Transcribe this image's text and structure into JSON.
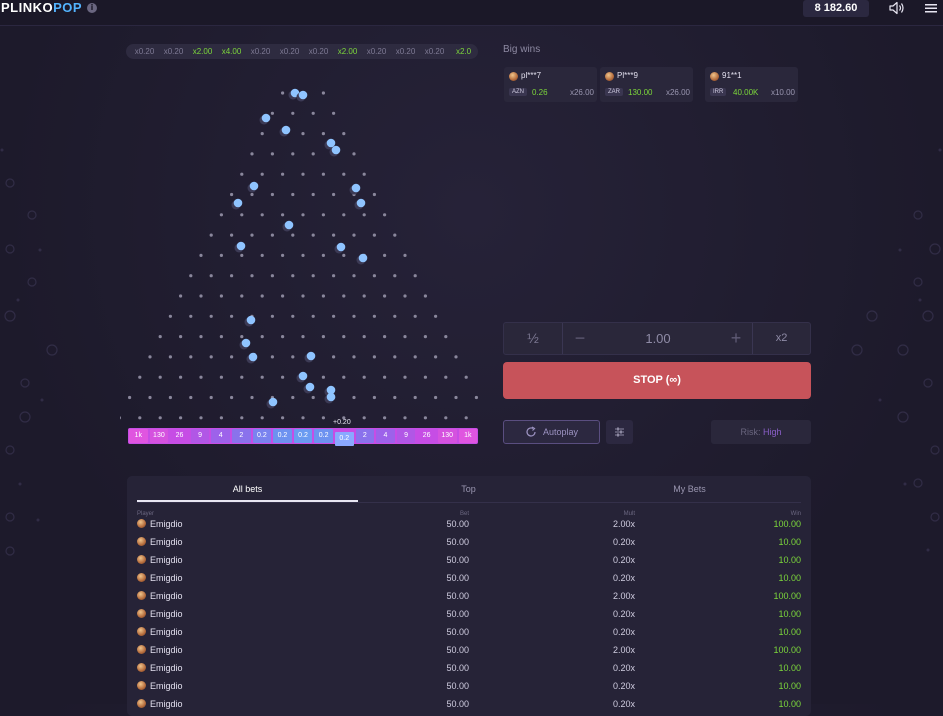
{
  "header": {
    "logo_main": "PLINKO",
    "logo_accent": "POP",
    "info_glyph": "i",
    "balance": "8 182.60",
    "icons": [
      "info-icon",
      "sound-icon",
      "menu-icon"
    ]
  },
  "history": [
    "x0.20",
    "x0.20",
    "x2.00",
    "x4.00",
    "x0.20",
    "x0.20",
    "x0.20",
    "x2.00",
    "x0.20",
    "x0.20",
    "x0.20",
    "x2.0"
  ],
  "board": {
    "pin_rows": 17,
    "ball_color": "#8fc4ff",
    "pin_color": "#8a879c"
  },
  "last_win": "+0.20",
  "slots": [
    "1k",
    "130",
    "26",
    "9",
    "4",
    "2",
    "0.2",
    "0.2",
    "0.2",
    "0.2",
    "0.2",
    "2",
    "4",
    "9",
    "26",
    "130",
    "1k"
  ],
  "big_wins": {
    "title": "Big wins",
    "cards": [
      {
        "player": "pl***7",
        "currency": "AZN",
        "amount": "0.26",
        "multiplier": "x26.00"
      },
      {
        "player": "Pl***9",
        "currency": "ZAR",
        "amount": "130.00",
        "multiplier": "x26.00"
      },
      {
        "player": "91**1",
        "currency": "IRR",
        "amount": "40.00K",
        "multiplier": "x10.00"
      }
    ]
  },
  "bet": {
    "half_label": "½",
    "minus_label": "−",
    "value": "1.00",
    "plus_label": "+",
    "double_label": "x2"
  },
  "stop_label": "STOP (∞)",
  "autoplay_label": "Autoplay",
  "risk": {
    "label": "Risk: ",
    "value": "High"
  },
  "colors": {
    "stop": "#c7535a",
    "win_green": "#7cd63b",
    "accent_blue": "#53b4ff",
    "slot_magenta": "#c64de5"
  },
  "bets_table": {
    "tabs": [
      "All bets",
      "Top",
      "My Bets"
    ],
    "columns": {
      "player": "Player",
      "bet": "Bet",
      "mult": "Mult",
      "win": "Win"
    },
    "rows": [
      {
        "player": "Emigdio",
        "bet": "50.00",
        "mult": "2.00x",
        "win": "100.00"
      },
      {
        "player": "Emigdio",
        "bet": "50.00",
        "mult": "0.20x",
        "win": "10.00"
      },
      {
        "player": "Emigdio",
        "bet": "50.00",
        "mult": "0.20x",
        "win": "10.00"
      },
      {
        "player": "Emigdio",
        "bet": "50.00",
        "mult": "0.20x",
        "win": "10.00"
      },
      {
        "player": "Emigdio",
        "bet": "50.00",
        "mult": "2.00x",
        "win": "100.00"
      },
      {
        "player": "Emigdio",
        "bet": "50.00",
        "mult": "0.20x",
        "win": "10.00"
      },
      {
        "player": "Emigdio",
        "bet": "50.00",
        "mult": "0.20x",
        "win": "10.00"
      },
      {
        "player": "Emigdio",
        "bet": "50.00",
        "mult": "2.00x",
        "win": "100.00"
      },
      {
        "player": "Emigdio",
        "bet": "50.00",
        "mult": "0.20x",
        "win": "10.00"
      },
      {
        "player": "Emigdio",
        "bet": "50.00",
        "mult": "0.20x",
        "win": "10.00"
      },
      {
        "player": "Emigdio",
        "bet": "50.00",
        "mult": "0.20x",
        "win": "10.00"
      }
    ]
  }
}
